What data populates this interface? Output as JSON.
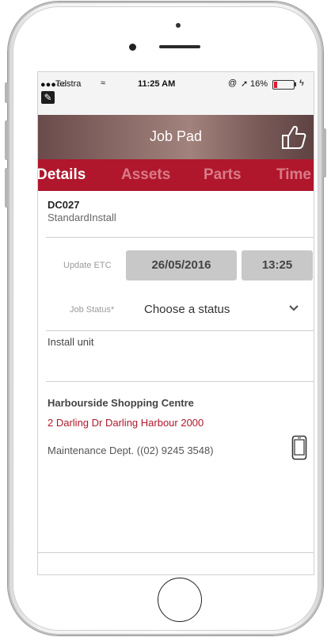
{
  "statusbar": {
    "signal": "●●●○○",
    "carrier": "Telstra",
    "wifi_glyph": "≈",
    "time": "11:25 AM",
    "lock_glyph": "@",
    "location_glyph": "➚",
    "battery_percent": "16%",
    "battery_level": 0.16,
    "charge_glyph": "ϟ",
    "battery_color": "#e0192e"
  },
  "navbar": {
    "title": "Job Pad"
  },
  "tabs": [
    {
      "label": "Details",
      "active": true
    },
    {
      "label": "Assets",
      "active": false
    },
    {
      "label": "Parts",
      "active": false
    },
    {
      "label": "Time",
      "active": false
    }
  ],
  "job": {
    "code": "DC027",
    "type": "StandardInstall"
  },
  "update_etc": {
    "label": "Update ETC",
    "date": "26/05/2016",
    "time": "13:25"
  },
  "job_status": {
    "label": "Job Status*",
    "value": "Choose a status"
  },
  "note": "Install unit",
  "site": {
    "name": "Harbourside Shopping Centre",
    "address": "2 Darling Dr  Darling Harbour 2000",
    "contact": "Maintenance Dept.  ((02) 9245 3548)"
  },
  "colors": {
    "brand_red": "#b0172c",
    "inactive_tab": "#d97b87",
    "button_grey": "#c8c8c8"
  },
  "icons": {
    "thumbs": "thumbs-up-icon",
    "phone": "mobile-phone-icon",
    "chevron": "chevron-down-icon"
  }
}
